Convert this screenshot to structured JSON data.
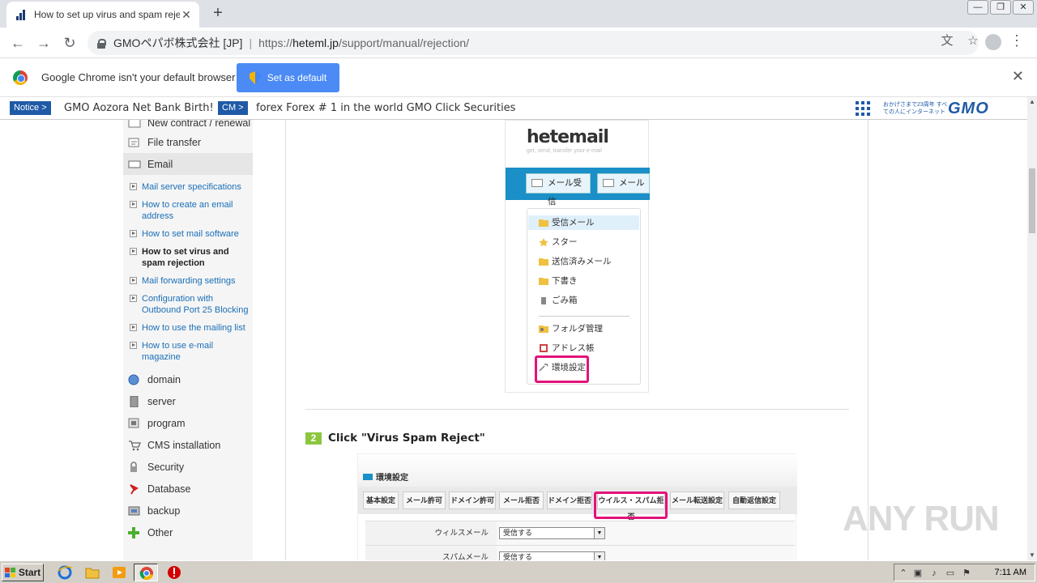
{
  "browser": {
    "tab_title": "How to set up virus and spam reject",
    "tab_close": "✕",
    "new_tab": "+",
    "window_controls": [
      "—",
      "❐",
      "✕"
    ],
    "nav": {
      "back": "←",
      "forward": "→",
      "reload": "↻"
    },
    "org": "GMOペパボ株式会社 [JP]",
    "url_scheme": "https://",
    "url_host": "heteml.jp",
    "url_path": "/support/manual/rejection/",
    "menu_glyph": "⋮"
  },
  "infobar": {
    "message": "Google Chrome isn't your default browser",
    "button": "Set as default",
    "close": "✕"
  },
  "gmobar": {
    "notice_badge": "Notice >",
    "notice_text": "GMO Aozora Net Bank Birth!",
    "cm_badge": "CM >",
    "cm_text": "forex Forex # 1 in the world GMO Click Securities",
    "tagline": "おかげさまで23周年 すべての人にインターネット",
    "logo": "GMO"
  },
  "sidebar": {
    "top_cut": "New contract / renewal",
    "file_transfer": "File transfer",
    "email": "Email",
    "email_sub": [
      "Mail server specifications",
      "How to create an email address",
      "How to set mail software",
      "How to set virus and spam rejection",
      "Mail forwarding settings",
      "Configuration with Outbound Port 25 Blocking",
      "How to use the mailing list",
      "How to use e-mail magazine"
    ],
    "domain": "domain",
    "server": "server",
    "program": "program",
    "cms": "CMS installation",
    "security": "Security",
    "database": "Database",
    "backup": "backup",
    "other": "Other"
  },
  "hetemail": {
    "logo": "hetemail",
    "tagline": "get, send, transfer your e-mail",
    "btn_receive": "メール受信",
    "btn_compose": "メール作",
    "folders": [
      "受信メール",
      "スター",
      "送信済みメール",
      "下書き",
      "ごみ箱"
    ],
    "folder_admin": "フォルダ管理",
    "address_book": "アドレス帳",
    "settings": "環境設定"
  },
  "step2": {
    "num": "2",
    "text": "Click \"Virus Spam Reject\""
  },
  "settings_shot": {
    "title": "環境設定",
    "tabs": [
      "基本設定",
      "メール許可",
      "ドメイン許可",
      "メール拒否",
      "ドメイン拒否",
      "ウイルス・スパム拒否",
      "メール転送設定",
      "自動返信設定"
    ],
    "rows": [
      {
        "label": "ウィルスメール",
        "value": "受信する"
      },
      {
        "label": "スパムメール",
        "value": "受信する"
      }
    ]
  },
  "watermark": "ANY RUN",
  "taskbar": {
    "start": "Start",
    "clock": "7:11 AM"
  }
}
